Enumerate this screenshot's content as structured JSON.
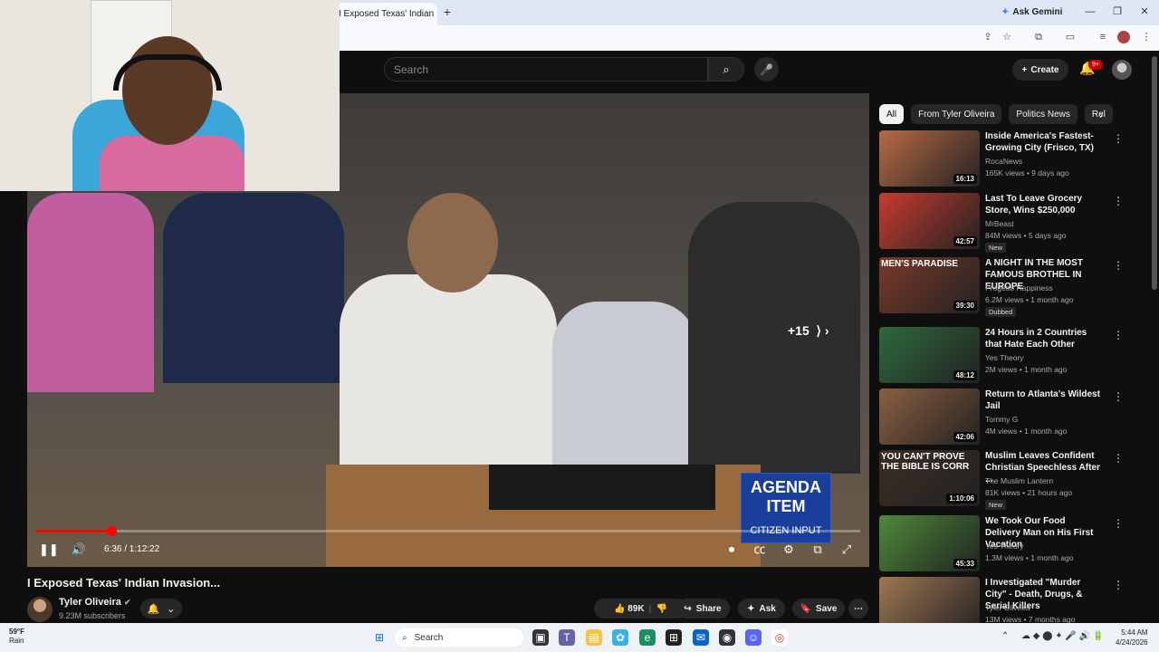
{
  "browser": {
    "tab_title": "I Exposed Texas' Indian",
    "gemini_label": "Ask Gemini"
  },
  "header": {
    "search_placeholder": "Search",
    "create_label": "Create",
    "notif_count": "9+"
  },
  "player": {
    "time": "6:36 / 1:12:22",
    "progress": 0.091,
    "seek_hint": "+15",
    "agenda_title": "AGENDA ITEM",
    "agenda_sub": "CITIZEN INPUT"
  },
  "video": {
    "title": "I Exposed Texas' Indian Invasion...",
    "channel": "Tyler Oliveira",
    "subscribers": "9.23M subscribers",
    "likes": "89K",
    "share": "Share",
    "ask": "Ask",
    "save": "Save"
  },
  "chips": [
    "All",
    "From Tyler Oliveira",
    "Politics News",
    "Rel"
  ],
  "recs": [
    {
      "title": "Inside America's Fastest-Growing City (Frisco, TX)",
      "channel": "RocaNews",
      "meta": "165K views • 9 days ago",
      "duration": "16:13",
      "badge": "",
      "color": "#b86b45"
    },
    {
      "title": "Last To Leave Grocery Store, Wins $250,000",
      "channel": "MrBeast",
      "meta": "84M views • 5 days ago",
      "duration": "42:57",
      "badge": "New",
      "color": "#c83b2f"
    },
    {
      "title": "A NIGHT IN THE MOST FAMOUS BROTHEL IN EUROPE",
      "channel": "Progetto Happiness",
      "meta": "6.2M views • 1 month ago",
      "duration": "39:30",
      "badge": "Dubbed",
      "color": "#7a3a2a",
      "overlay": "MEN'S PARADISE"
    },
    {
      "title": "24 Hours in 2 Countries that Hate Each Other",
      "channel": "Yes Theory",
      "meta": "2M views • 1 month ago",
      "duration": "48:12",
      "badge": "",
      "color": "#2d6a3b"
    },
    {
      "title": "Return to Atlanta's Wildest Jail",
      "channel": "Tommy G",
      "meta": "4M views • 1 month ago",
      "duration": "42:06",
      "badge": "",
      "color": "#8a6040"
    },
    {
      "title": "Muslim Leaves Confident Christian Speechless After ...",
      "channel": "The Muslim Lantern",
      "meta": "81K views • 21 hours ago",
      "duration": "1:10:06",
      "badge": "New",
      "color": "#3b2d24",
      "overlay": "YOU CAN'T PROVE THE BIBLE IS CORR"
    },
    {
      "title": "We Took Our Food Delivery Man on His First Vacation",
      "channel": "Yes Theory",
      "meta": "1.3M views • 1 month ago",
      "duration": "45:33",
      "badge": "",
      "color": "#4d8a3a"
    },
    {
      "title": "I Investigated \"Murder City\" - Death, Drugs, & Serial Killers",
      "channel": "Tyler Oliveira",
      "meta": "13M views • 7 months ago",
      "duration": "",
      "badge": "",
      "color": "#a07850"
    }
  ],
  "taskbar": {
    "temp": "59°F",
    "weather": "Rain",
    "search": "Search",
    "time": "5:44 AM",
    "date": "4/24/2026"
  }
}
